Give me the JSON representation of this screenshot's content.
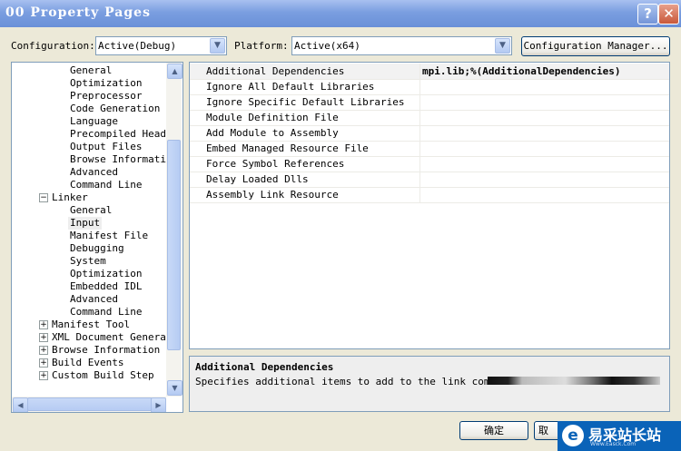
{
  "window": {
    "title": "00 Property Pages",
    "help_label": "?",
    "close_label": "✕"
  },
  "config_bar": {
    "configuration_label": "Configuration:",
    "configuration_value": "Active(Debug)",
    "platform_label": "Platform:",
    "platform_value": "Active(x64)",
    "config_manager_label": "Configuration Manager..."
  },
  "tree": {
    "items": [
      {
        "label": "General"
      },
      {
        "label": "Optimization"
      },
      {
        "label": "Preprocessor"
      },
      {
        "label": "Code Generation"
      },
      {
        "label": "Language"
      },
      {
        "label": "Precompiled Heade"
      },
      {
        "label": "Output Files"
      },
      {
        "label": "Browse Informatio"
      },
      {
        "label": "Advanced"
      },
      {
        "label": "Command Line"
      },
      {
        "label": "Linker",
        "expander": "−"
      },
      {
        "label": "General"
      },
      {
        "label": "Input",
        "selected": true
      },
      {
        "label": "Manifest File"
      },
      {
        "label": "Debugging"
      },
      {
        "label": "System"
      },
      {
        "label": "Optimization"
      },
      {
        "label": "Embedded IDL"
      },
      {
        "label": "Advanced"
      },
      {
        "label": "Command Line"
      },
      {
        "label": "Manifest Tool",
        "expander": "+"
      },
      {
        "label": "XML Document Generato",
        "expander": "+"
      },
      {
        "label": "Browse Information",
        "expander": "+"
      },
      {
        "label": "Build Events",
        "expander": "+"
      },
      {
        "label": "Custom Build Step",
        "expander": "+"
      }
    ]
  },
  "properties": [
    {
      "name": "Additional Dependencies",
      "value": "mpi.lib;%(AdditionalDependencies)",
      "selected": true
    },
    {
      "name": "Ignore All Default Libraries",
      "value": ""
    },
    {
      "name": "Ignore Specific Default Libraries",
      "value": ""
    },
    {
      "name": "Module Definition File",
      "value": ""
    },
    {
      "name": "Add Module to Assembly",
      "value": ""
    },
    {
      "name": "Embed Managed Resource File",
      "value": ""
    },
    {
      "name": "Force Symbol References",
      "value": ""
    },
    {
      "name": "Delay Loaded Dlls",
      "value": ""
    },
    {
      "name": "Assembly Link Resource",
      "value": ""
    }
  ],
  "description": {
    "title": "Additional Dependencies",
    "text": "Specifies additional items to add to the link command"
  },
  "footer": {
    "ok_label": "确定",
    "cancel_label": "取"
  },
  "watermark": {
    "name": "易采站长站",
    "mark": "e",
    "url": "Www.Easck.Com"
  },
  "colors": {
    "titlebar": "#7a9ee0",
    "dialog_bg": "#ece9d8",
    "border": "#7f9db9",
    "watermark": "#0a63b8"
  },
  "icons": {
    "help": "question-mark-icon",
    "close": "close-x-icon",
    "expand": "plus-box-icon",
    "collapse": "minus-box-icon",
    "dropdown": "chevron-down-icon"
  }
}
